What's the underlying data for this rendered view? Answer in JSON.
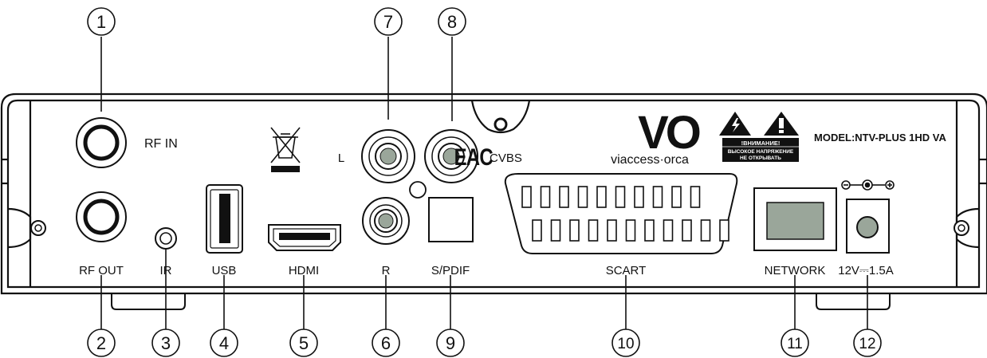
{
  "callouts": {
    "n1": "1",
    "n2": "2",
    "n3": "3",
    "n4": "4",
    "n5": "5",
    "n6": "6",
    "n7": "7",
    "n8": "8",
    "n9": "9",
    "n10": "10",
    "n11": "11",
    "n12": "12"
  },
  "ports": {
    "rf_in": "RF IN",
    "rf_out": "RF OUT",
    "ir": "IR",
    "usb": "USB",
    "hdmi": "HDMI",
    "audio_l": "L",
    "audio_r": "R",
    "cvbs": "CVBS",
    "spdif": "S/PDIF",
    "scart": "SCART",
    "network": "NETWORK",
    "power": "12V⎓1.5A"
  },
  "branding": {
    "eac": "EAC",
    "vo_logo": "VO",
    "viaccess": "viaccess·orca",
    "model": "MODEL:NTV-PLUS 1HD VA",
    "warning_title": "!ВНИМАНИЕ!",
    "warning_line1": "ВЫСОКОЕ НАПРЯЖЕНИЕ",
    "warning_line2": "НЕ ОТКРЫВАТЬ"
  },
  "colors": {
    "line": "#111111",
    "connector_fill": "#9aa69a",
    "network_fill": "#9aa69a",
    "background": "#ffffff"
  }
}
